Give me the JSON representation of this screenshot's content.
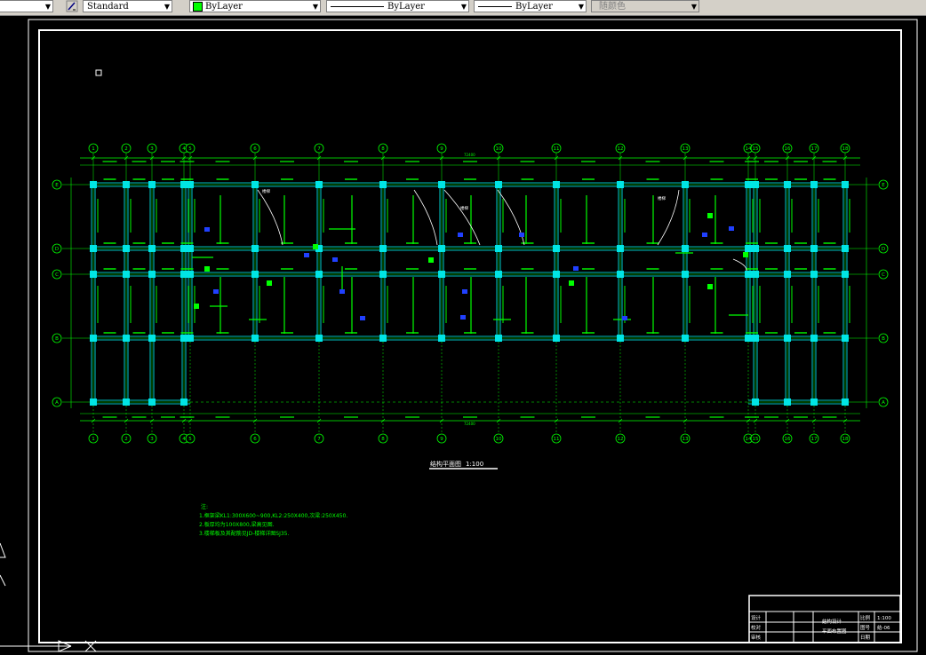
{
  "toolbar": {
    "text_style": "Standard",
    "layer_color": "ByLayer",
    "linetype": "ByLayer",
    "lineweight": "ByLayer",
    "plot_style": "随颜色"
  },
  "drawing": {
    "grid_top": [
      "1",
      "2",
      "3",
      "4",
      "5",
      "6",
      "7",
      "8",
      "9",
      "10",
      "11",
      "12",
      "13",
      "14",
      "15",
      "16",
      "17",
      "18"
    ],
    "grid_left": [
      "E",
      "D",
      "C",
      "B",
      "A"
    ],
    "overall_dim": "72400",
    "plan_title": "结构平面图",
    "plan_scale": "1:100",
    "notes_heading": "注:",
    "notes": [
      "1.框架梁KL1:300X600~900,KL2:250X400,次梁:250X450.",
      "2.板厚均为100X800,梁高见图.",
      "3.楼梯板及其配筋见JD-楼梯详图SJ35."
    ],
    "labels": {
      "stair": "楼梯"
    },
    "titleblock": {
      "rows": [
        "设计",
        "校对",
        "审核"
      ],
      "project": [
        "结构设计",
        "平面布置图"
      ],
      "scale_label": "比例",
      "scale_value": "1:100",
      "sheet_label": "图号",
      "sheet_value": "结-06",
      "date_label": "日期"
    }
  }
}
